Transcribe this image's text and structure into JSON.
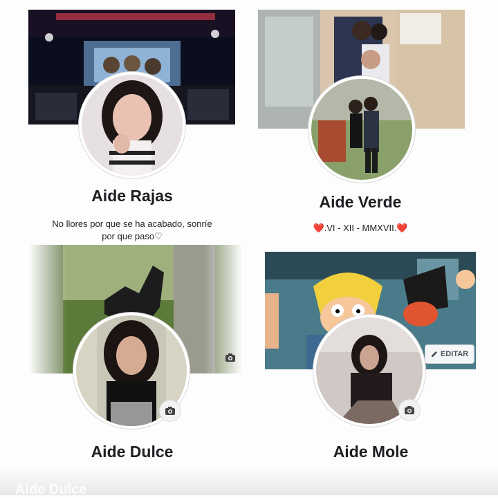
{
  "profiles": [
    {
      "name": "Aide Rajas",
      "bio": ""
    },
    {
      "name": "Aide Verde",
      "bio": "❤️.VI - XII - MMXVII.❤️"
    },
    {
      "name": "Aide Dulce",
      "bio": "No llores por que se ha acabado, sonríe por que paso♡"
    },
    {
      "name": "Aide Mole",
      "bio": ""
    }
  ],
  "edit_button": {
    "label": "EDITAR",
    "icon": "pencil-icon"
  },
  "camera_icon": "camera-icon",
  "footer": {
    "watermark": "Aide Dulce"
  }
}
